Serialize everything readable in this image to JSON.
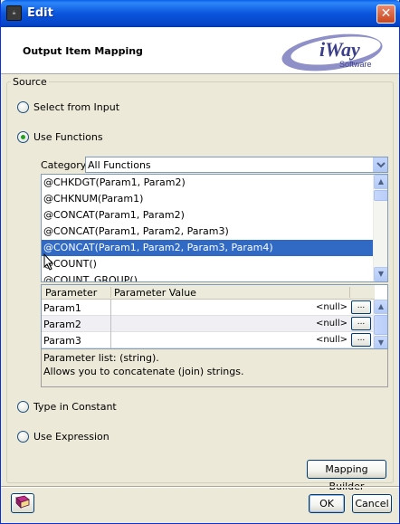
{
  "window": {
    "title": "Edit",
    "app_icon": "java-cup-icon",
    "close_glyph": "✕"
  },
  "header": {
    "title": "Output Item Mapping",
    "logo_text": "iWay",
    "logo_subtext": "Software"
  },
  "source": {
    "legend": "Source",
    "options": {
      "select_from_input": "Select from Input",
      "use_functions": "Use Functions",
      "type_in_constant": "Type in Constant",
      "use_expression": "Use Expression"
    },
    "selected": "use_functions"
  },
  "category": {
    "label": "Category:",
    "value": "All Functions"
  },
  "functions": [
    "@CHKDGT(Param1, Param2)",
    "@CHKNUM(Param1)",
    "@CONCAT(Param1, Param2)",
    "@CONCAT(Param1, Param2, Param3)",
    "@CONCAT(Param1, Param2, Param3, Param4)",
    "@COUNT()",
    "@COUNT_GROUP()"
  ],
  "selected_function_index": 4,
  "parameters": {
    "headers": [
      "Parameter",
      "Parameter Value"
    ],
    "rows": [
      {
        "name": "Param1",
        "value": "<null>",
        "button": "..."
      },
      {
        "name": "Param2",
        "value": "<null>",
        "button": "..."
      },
      {
        "name": "Param3",
        "value": "<null>",
        "button": "..."
      }
    ]
  },
  "description": {
    "line1": "Parameter list: (string).",
    "line2": "Allows you to concatenate (join) strings."
  },
  "buttons": {
    "mapping_builder": "Mapping Builder",
    "ok": "OK",
    "cancel": "Cancel"
  },
  "colors": {
    "selection": "#316ac5",
    "titlebar": "#0a55dd",
    "dialog_bg": "#ece9d8",
    "logo_accent": "#4b4f9c"
  }
}
